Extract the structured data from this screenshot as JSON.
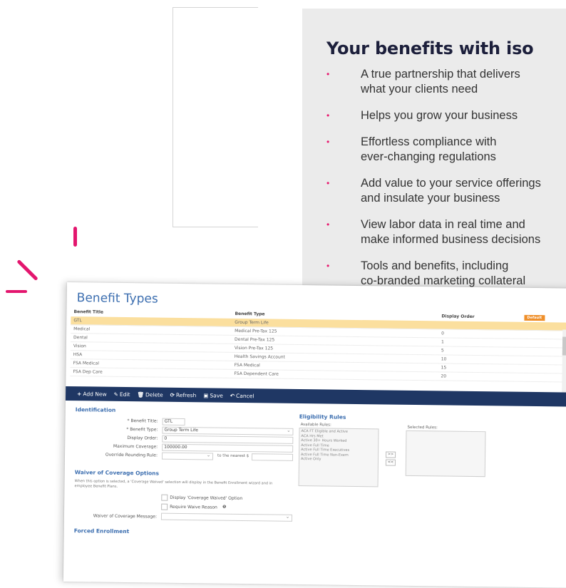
{
  "marketing": {
    "title": "Your benefits with iso",
    "bullets": [
      "A true partnership that delivers\nwhat your clients need",
      "Helps you grow your business",
      "Effortless compliance with\never-changing regulations",
      "Add value to your service offerings\nand insulate your business",
      "View labor data in real time and\nmake informed business decisions",
      "Tools and benefits, including\nco-branded marketing collateral"
    ],
    "accent_color": "#e3166e",
    "panel_color": "#ebebeb"
  },
  "app": {
    "title": "Benefit Types",
    "columns": [
      "Benefit Title",
      "Benefit Type",
      "Display Order"
    ],
    "default_badge": "Default",
    "rows": [
      {
        "title": "GTL",
        "type": "Group Term Life",
        "order": "",
        "selected": true
      },
      {
        "title": "Medical",
        "type": "Medical Pre-Tax 125",
        "order": "0"
      },
      {
        "title": "Dental",
        "type": "Dental Pre-Tax 125",
        "order": "1"
      },
      {
        "title": "Vision",
        "type": "Vision Pre-Tax 125",
        "order": "5"
      },
      {
        "title": "HSA",
        "type": "Health Savings Account",
        "order": "10"
      },
      {
        "title": "FSA Medical",
        "type": "FSA Medical",
        "order": "15"
      },
      {
        "title": "FSA Dep Care",
        "type": "FSA Dependent Care",
        "order": "20"
      }
    ],
    "toolbar": {
      "add": "Add New",
      "edit": "Edit",
      "delete": "Delete",
      "refresh": "Refresh",
      "save": "Save",
      "cancel": "Cancel"
    },
    "identification": {
      "heading": "Identification",
      "benefit_title_label": "* Benefit Title:",
      "benefit_title_value": "GTL",
      "benefit_type_label": "* Benefit Type:",
      "benefit_type_value": "Group Term Life",
      "display_order_label": "Display Order:",
      "display_order_value": "0",
      "max_coverage_label": "Maximum Coverage:",
      "max_coverage_value": "100000.00",
      "rounding_label": "Override Rounding Rule:",
      "rounding_suffix": "to the nearest $"
    },
    "eligibility": {
      "heading": "Eligibility Rules",
      "available_label": "Available Rules:",
      "selected_label": "Selected Rules:",
      "available_rules": [
        "ACA FT Eligible and Active",
        "ACA Hrs Met",
        "Active 30+ Hours Worked",
        "Active Full Time",
        "Active Full Time Executives",
        "Active Full Time Non-Exem",
        "Active Only"
      ],
      "add_btn": ">>",
      "remove_btn": "<<"
    },
    "waiver": {
      "heading": "Waiver of Coverage Options",
      "note": "When this option is selected, a 'Coverage Waived' selection will display in the Benefit Enrollment wizard and in employee Benefit Plans.",
      "display_waived": "Display 'Coverage Waived' Option",
      "require_reason": "Require Waive Reason",
      "message_label": "Waiver of Coverage Message:"
    },
    "forced": {
      "heading": "Forced Enrollment"
    }
  }
}
